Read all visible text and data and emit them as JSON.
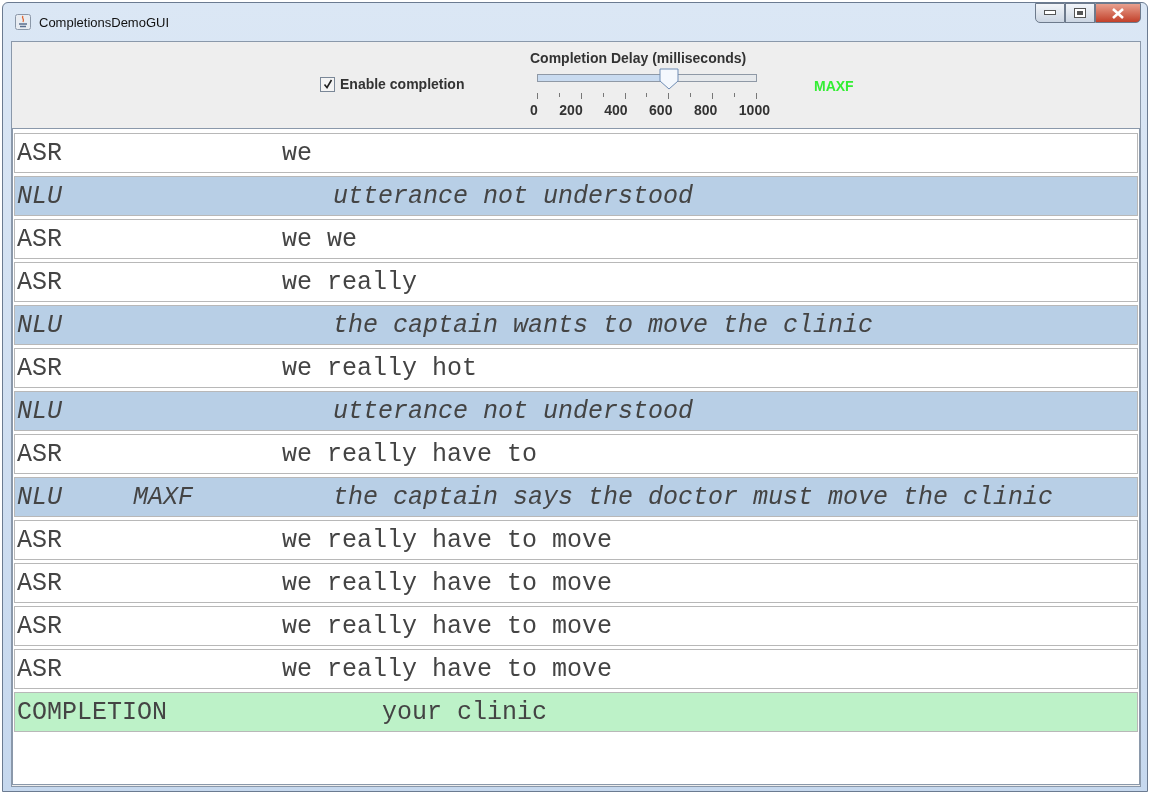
{
  "window": {
    "title": "CompletionsDemoGUI"
  },
  "controls": {
    "enable_completion": {
      "label": "Enable completion",
      "checked": true
    },
    "delay_slider": {
      "title": "Completion Delay (milliseconds)",
      "level": 0.6,
      "tick_labels": [
        "0",
        "200",
        "400",
        "600",
        "800",
        "1000"
      ]
    },
    "status": "MAXF"
  },
  "log": [
    {
      "kind": "asr",
      "source": "ASR",
      "text": "we"
    },
    {
      "kind": "nlu",
      "source": "NLU",
      "text": "utterance not understood"
    },
    {
      "kind": "asr",
      "source": "ASR",
      "text": "we we"
    },
    {
      "kind": "asr",
      "source": "ASR",
      "text": "we really"
    },
    {
      "kind": "nlu",
      "source": "NLU",
      "text": "the captain wants to move the clinic"
    },
    {
      "kind": "asr",
      "source": "ASR",
      "text": "we really hot"
    },
    {
      "kind": "nlu",
      "source": "NLU",
      "text": "utterance not understood"
    },
    {
      "kind": "asr",
      "source": "ASR",
      "text": "we really have to"
    },
    {
      "kind": "nlu",
      "source": "NLU",
      "tag": "MAXF",
      "text": "the captain says the doctor must move the clinic"
    },
    {
      "kind": "asr",
      "source": "ASR",
      "text": "we really have to move"
    },
    {
      "kind": "asr",
      "source": "ASR",
      "text": "we really have to move"
    },
    {
      "kind": "asr",
      "source": "ASR",
      "text": "we really have to move"
    },
    {
      "kind": "asr",
      "source": "ASR",
      "text": "we really have to move"
    },
    {
      "kind": "completion",
      "source": "COMPLETION",
      "text": "your clinic"
    }
  ]
}
